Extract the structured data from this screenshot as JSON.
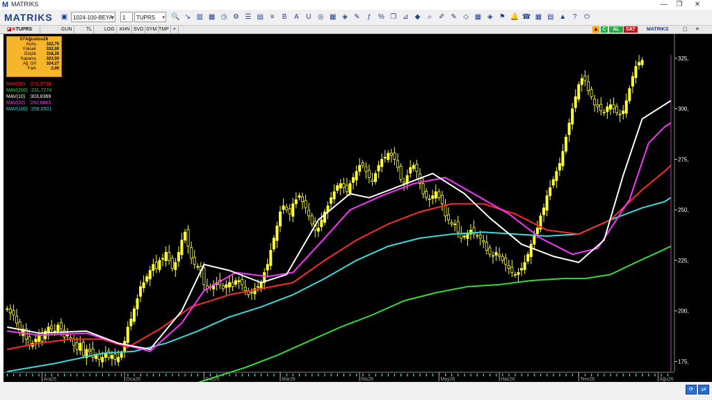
{
  "window": {
    "title": "MATRIKS",
    "logo": "M"
  },
  "toolbar": {
    "brand": "MATRIKS",
    "template_combo": "1024-100-BEYA",
    "count_combo": "1",
    "symbol_combo": "TUPRS"
  },
  "chartbar": {
    "symbol": "TUPRS",
    "periods": [
      "GUN",
      "TL",
      "LOG",
      "KHN",
      "SVD",
      "SYM",
      "TMP"
    ],
    "flag_c": "C",
    "flag_al": "AL",
    "flag_sat": "SAT",
    "brand": "MATRIKS"
  },
  "info": {
    "date": "07Ağustos26",
    "rows": [
      {
        "label": "Açılış",
        "value": "322,75"
      },
      {
        "label": "Yüksek",
        "value": "332,00"
      },
      {
        "label": "Düşük",
        "value": "318,25"
      },
      {
        "label": "Kapanış",
        "value": "323,50"
      },
      {
        "label": "Ağ. Ort",
        "value": "324,27"
      },
      {
        "label": "Fark",
        "value": "2,00"
      }
    ]
  },
  "colors": {
    "bg": "#000000",
    "candle": "#ffff33",
    "mav50": "#ff2a2a",
    "mav200": "#33dd33",
    "mav10": "#ffffff",
    "mav20": "#ff33ff",
    "mav100": "#33dddd",
    "axis": "#ffffff",
    "tick": "#33dddd"
  },
  "chart_data": {
    "type": "candlestick",
    "series": [
      {
        "name": "MAV(50)",
        "value": ":272,3739",
        "color": "#ff2a2a"
      },
      {
        "name": "MAV(200)",
        "value": ":231,7274",
        "color": "#33dd33"
      },
      {
        "name": "MAV(10)",
        "value": ":303,8369",
        "color": "#ffffff"
      },
      {
        "name": "MAV(20)",
        "value": ":292,8865",
        "color": "#ff33ff"
      },
      {
        "name": "MAV(100)",
        "value": ":256,0501",
        "color": "#33dddd"
      }
    ],
    "yticks": [
      "325,",
      "300,",
      "275,",
      "250,",
      "225,",
      "200,",
      "175,"
    ],
    "ytick_values": [
      325,
      300,
      275,
      250,
      225,
      200,
      175
    ],
    "ylim": [
      170,
      337
    ],
    "xlabels": [
      "Ara25",
      "Oca26",
      "Şub26",
      "Mar26",
      "Nis26",
      "May26",
      "Haz26",
      "Tem26",
      "Ağu26"
    ],
    "xlabel_index": [
      11,
      37,
      62,
      86,
      111,
      136,
      155,
      180,
      205
    ],
    "n_bars": 210,
    "close": [
      201,
      199,
      198,
      194,
      189,
      191,
      186,
      183,
      184,
      186,
      188,
      185,
      190,
      192,
      191,
      190,
      193,
      191,
      187,
      188,
      186,
      183,
      181,
      184,
      178,
      181,
      180,
      177,
      178,
      176,
      177,
      179,
      177,
      178,
      176,
      177,
      179,
      185,
      192,
      196,
      201,
      206,
      212,
      214,
      217,
      220,
      223,
      221,
      225,
      226,
      229,
      225,
      221,
      224,
      229,
      235,
      239,
      232,
      226,
      223,
      222,
      220,
      213,
      211,
      212,
      213,
      214,
      213,
      211,
      213,
      214,
      212,
      215,
      215,
      213,
      210,
      208,
      209,
      211,
      212,
      214,
      219,
      223,
      230,
      236,
      242,
      249,
      252,
      250,
      248,
      253,
      255,
      257,
      254,
      251,
      247,
      243,
      240,
      241,
      245,
      249,
      252,
      256,
      259,
      262,
      263,
      261,
      259,
      263,
      266,
      269,
      272,
      272,
      269,
      266,
      264,
      268,
      272,
      275,
      276,
      278,
      277,
      275,
      271,
      265,
      263,
      267,
      271,
      272,
      269,
      263,
      258,
      256,
      255,
      257,
      259,
      256,
      253,
      247,
      245,
      243,
      243,
      239,
      236,
      237,
      238,
      240,
      238,
      237,
      236,
      234,
      230,
      228,
      227,
      229,
      227,
      225,
      223,
      221,
      219,
      218,
      219,
      221,
      224,
      228,
      233,
      237,
      241,
      247,
      251,
      257,
      261,
      265,
      269,
      273,
      279,
      286,
      293,
      300,
      306,
      312,
      315,
      314,
      309,
      306,
      302,
      301,
      299,
      298,
      301,
      302,
      300,
      298,
      297,
      299,
      304,
      310,
      316,
      321,
      323,
      324
    ],
    "ma_pts": {
      "mav10": [
        [
          0,
          192
        ],
        [
          10,
          189
        ],
        [
          25,
          190
        ],
        [
          35,
          184
        ],
        [
          45,
          181
        ],
        [
          55,
          200
        ],
        [
          62,
          223
        ],
        [
          70,
          220
        ],
        [
          80,
          214
        ],
        [
          88,
          218
        ],
        [
          98,
          245
        ],
        [
          108,
          258
        ],
        [
          114,
          256
        ],
        [
          124,
          262
        ],
        [
          134,
          268
        ],
        [
          144,
          258
        ],
        [
          152,
          246
        ],
        [
          162,
          233
        ],
        [
          172,
          227
        ],
        [
          180,
          224
        ],
        [
          188,
          235
        ],
        [
          194,
          267
        ],
        [
          200,
          295
        ],
        [
          207,
          302
        ],
        [
          209,
          304
        ]
      ],
      "mav20": [
        [
          0,
          190
        ],
        [
          10,
          188
        ],
        [
          25,
          189
        ],
        [
          35,
          184
        ],
        [
          45,
          180
        ],
        [
          55,
          194
        ],
        [
          62,
          210
        ],
        [
          72,
          219
        ],
        [
          82,
          217
        ],
        [
          90,
          219
        ],
        [
          100,
          236
        ],
        [
          108,
          250
        ],
        [
          118,
          257
        ],
        [
          128,
          263
        ],
        [
          138,
          266
        ],
        [
          148,
          257
        ],
        [
          158,
          248
        ],
        [
          168,
          236
        ],
        [
          178,
          228
        ],
        [
          186,
          231
        ],
        [
          196,
          255
        ],
        [
          202,
          283
        ],
        [
          207,
          291
        ],
        [
          209,
          293
        ]
      ],
      "mav50": [
        [
          0,
          181
        ],
        [
          10,
          184
        ],
        [
          20,
          186
        ],
        [
          30,
          186
        ],
        [
          38,
          182
        ],
        [
          48,
          191
        ],
        [
          58,
          202
        ],
        [
          70,
          208
        ],
        [
          80,
          211
        ],
        [
          90,
          214
        ],
        [
          100,
          225
        ],
        [
          110,
          235
        ],
        [
          120,
          243
        ],
        [
          130,
          249
        ],
        [
          140,
          253
        ],
        [
          150,
          253
        ],
        [
          160,
          248
        ],
        [
          170,
          240
        ],
        [
          180,
          238
        ],
        [
          190,
          245
        ],
        [
          200,
          260
        ],
        [
          207,
          269
        ],
        [
          209,
          272
        ]
      ],
      "mav100": [
        [
          0,
          170
        ],
        [
          15,
          174
        ],
        [
          30,
          179
        ],
        [
          40,
          180
        ],
        [
          50,
          184
        ],
        [
          60,
          190
        ],
        [
          70,
          197
        ],
        [
          80,
          202
        ],
        [
          90,
          208
        ],
        [
          100,
          216
        ],
        [
          110,
          225
        ],
        [
          120,
          232
        ],
        [
          130,
          236
        ],
        [
          140,
          238
        ],
        [
          150,
          239
        ],
        [
          160,
          238
        ],
        [
          170,
          237
        ],
        [
          180,
          238
        ],
        [
          190,
          245
        ],
        [
          200,
          251
        ],
        [
          207,
          254
        ],
        [
          209,
          256
        ]
      ],
      "mav200": [
        [
          45,
          158
        ],
        [
          55,
          162
        ],
        [
          65,
          167
        ],
        [
          75,
          172
        ],
        [
          85,
          178
        ],
        [
          95,
          185
        ],
        [
          105,
          192
        ],
        [
          115,
          198
        ],
        [
          125,
          205
        ],
        [
          135,
          209
        ],
        [
          145,
          212
        ],
        [
          155,
          213
        ],
        [
          165,
          215
        ],
        [
          175,
          216
        ],
        [
          182,
          216
        ],
        [
          190,
          218
        ],
        [
          198,
          224
        ],
        [
          205,
          229
        ],
        [
          209,
          232
        ]
      ]
    }
  }
}
